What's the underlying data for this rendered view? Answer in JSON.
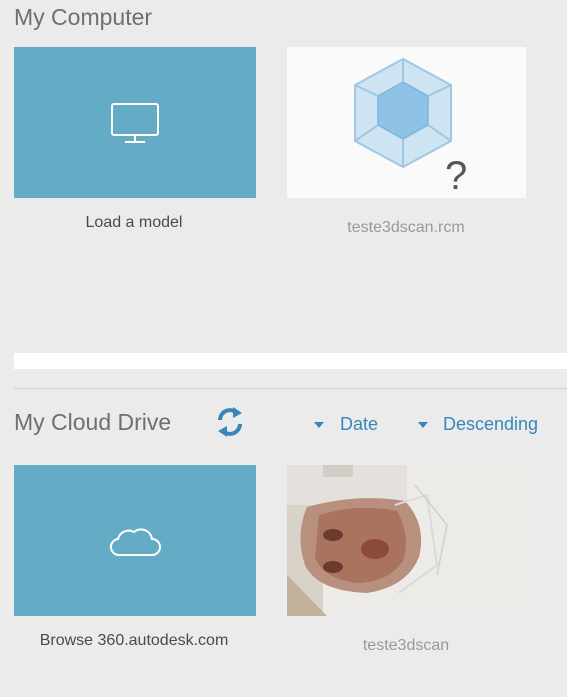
{
  "my_computer": {
    "title": "My Computer",
    "tiles": [
      {
        "label": "Load a model",
        "icon": "monitor-icon"
      },
      {
        "label": "teste3dscan.rcm",
        "icon": "cube-unknown-icon"
      }
    ]
  },
  "my_cloud_drive": {
    "title": "My Cloud Drive",
    "refresh_icon": "refresh-icon",
    "sort": {
      "field": "Date",
      "order": "Descending"
    },
    "tiles": [
      {
        "label": "Browse 360.autodesk.com",
        "icon": "cloud-icon"
      },
      {
        "label": "teste3dscan",
        "icon": "face-scan-thumbnail"
      }
    ]
  },
  "colors": {
    "tile_blue": "#64abc5",
    "link_blue": "#3a86b8",
    "background": "#ebebeb"
  }
}
